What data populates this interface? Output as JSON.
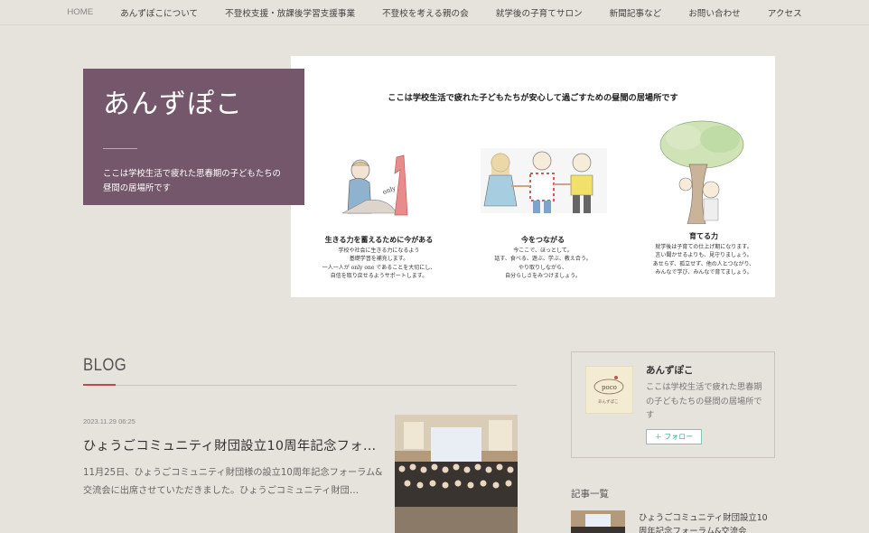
{
  "nav": {
    "items": [
      "HOME",
      "あんずぽこについて",
      "不登校支援・放課後学習支援事業",
      "不登校を考える親の会",
      "就学後の子育てサロン",
      "新聞記事など",
      "お問い合わせ",
      "アクセス"
    ]
  },
  "site": {
    "title": "あんずぽこ",
    "tagline": "ここは学校生活で疲れた思春期の子どもたちの昼間の居場所です"
  },
  "hero": {
    "caption": "ここは学校生活で疲れた子どもたちが安心して過ごすための昼間の居場所です",
    "columns": [
      {
        "heading": "生きる力を蓄えるために今がある",
        "body": "学校や社会に生きる力になるよう\n基礎学習を補充します。\n一人一人が only one であることを大切にし、\n自信を取り戻せるようサポートします。"
      },
      {
        "heading": "今をつながる",
        "body": "今ここで、ほっとして。\n話す、食べる、遊ぶ、学ぶ、教え合う。\nやり取りしながら、\n自分らしさをみつけましょう。"
      },
      {
        "heading": "育てる力",
        "body": "就学後は子育ての仕上げ期になります。\n言い聞かせるよりも、見守りましょう。\nあせらず、孤立せず、他の人とつながり、\nみんなで学び、みんなで育てましょう。"
      }
    ],
    "only_text": "only"
  },
  "blog": {
    "heading": "BLOG",
    "post": {
      "date": "2023.11.29 06:25",
      "title": "ひょうごコミュニティ財団設立10周年記念フォ…",
      "excerpt": "11月25日、ひょうごコミュニティ財団様の設立10周年記念フォーラム&交流会に出席させていただきました。ひょうごコミュニティ財団…"
    }
  },
  "profile": {
    "name": "あんずぽこ",
    "description": "ここは学校生活で疲れた思春期の子どもたちの昼間の居場所です",
    "follow_label": "＋ フォロー",
    "logo_text": "poco",
    "logo_sub": "あんずぽこ"
  },
  "article_list": {
    "heading": "記事一覧",
    "first_title": "ひょうごコミュニティ財団設立10周年記念フォーラム&交流会"
  },
  "colors": {
    "page_bg": "#e6e2dc",
    "title_box": "#74576b",
    "blog_accent": "#c04850",
    "follow_accent": "#3ea693"
  }
}
